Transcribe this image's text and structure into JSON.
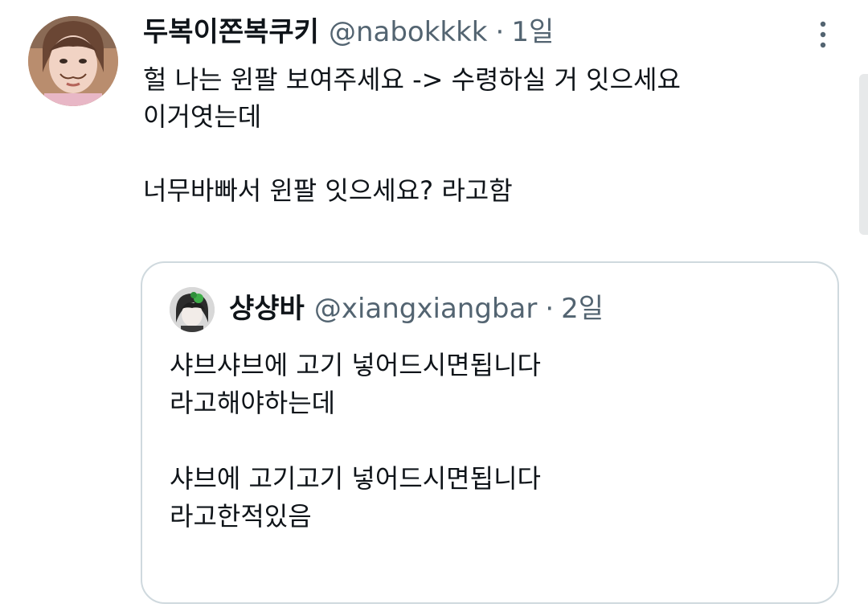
{
  "tweet": {
    "author": {
      "display_name": "두복이쫀복쿠키",
      "handle": "@nabokkkk",
      "separator": "·",
      "time": "1일",
      "avatar_icon": "user-photo-avatar"
    },
    "text": "헐 나는 윈팔 보여주세요 -> 수령하실 거 잇으세요\n이거엿는데\n\n너무바빠서 윈팔 잇으세요? 라고함",
    "more_icon": "more-vertical-icon"
  },
  "quote": {
    "author": {
      "display_name": "샹샹바",
      "handle": "@xiangxiangbar",
      "separator": "·",
      "time": "2일",
      "avatar_icon": "user-photo-avatar"
    },
    "text": "샤브샤브에 고기 넣어드시면됩니다\n라고해야하는데\n\n샤브에 고기고기 넣어드시면됩니다\n라고한적있음"
  },
  "colors": {
    "text_primary": "#0f1419",
    "text_secondary": "#536471",
    "border": "#cfd9de",
    "background": "#ffffff"
  }
}
